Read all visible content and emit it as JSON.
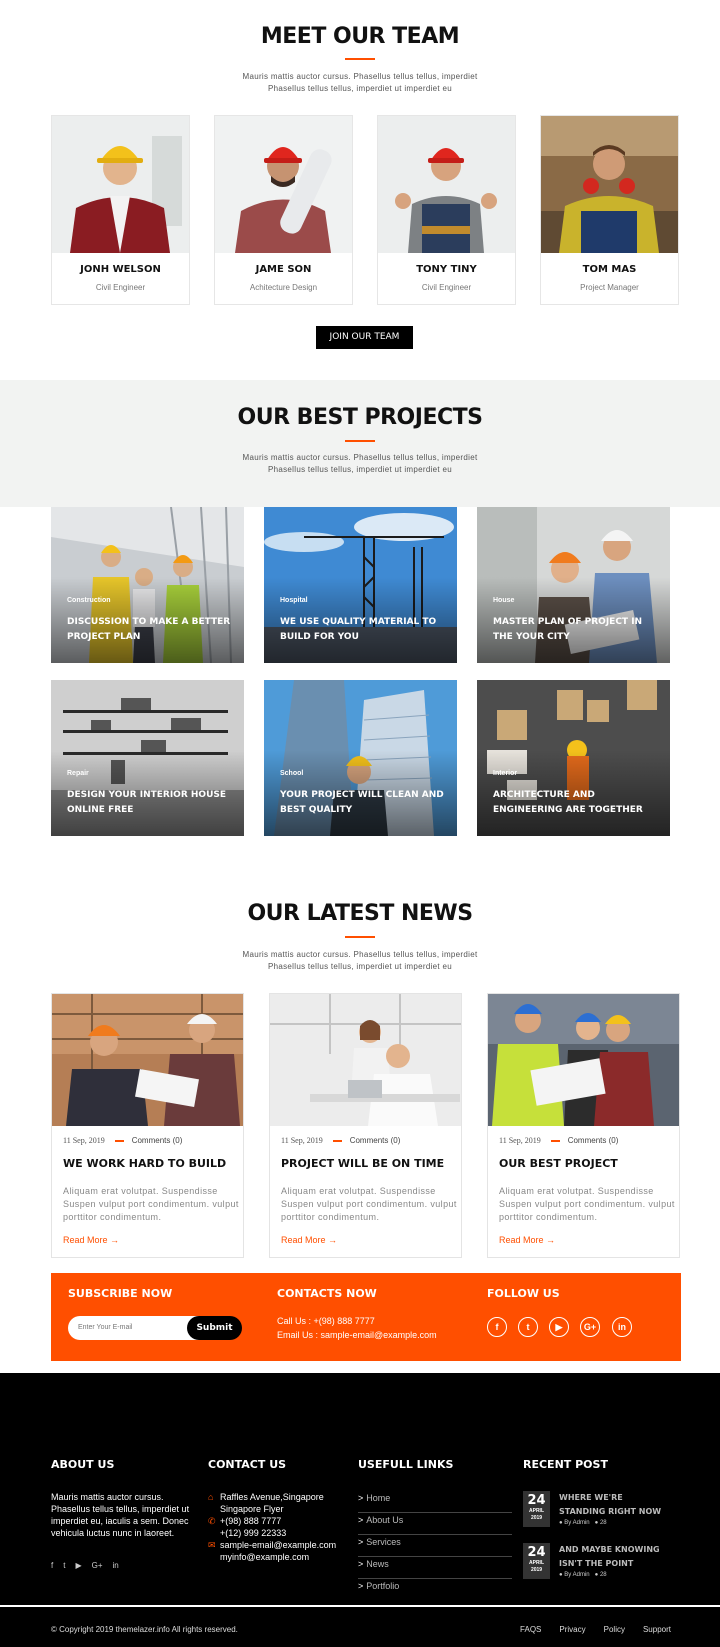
{
  "team_section": {
    "title": "MEET OUR TEAM",
    "subtitle_line1": "Mauris mattis auctor cursus. Phasellus tellus tellus, imperdiet",
    "subtitle_line2": "Phasellus tellus tellus, imperdiet ut imperdiet eu",
    "members": [
      {
        "name": "JONH WELSON",
        "role": "Civil Engineer"
      },
      {
        "name": "JAME SON",
        "role": "Achitecture Design"
      },
      {
        "name": "TONY TINY",
        "role": "Civil Engineer"
      },
      {
        "name": "TOM MAS",
        "role": "Project Manager"
      }
    ],
    "join_label": "JOIN OUR TEAM"
  },
  "projects_section": {
    "title": "OUR BEST PROJECTS",
    "subtitle_line1": "Mauris mattis auctor cursus. Phasellus tellus tellus, imperdiet",
    "subtitle_line2": "Phasellus tellus tellus, imperdiet ut imperdiet eu",
    "projects": [
      {
        "category": "Construction",
        "title": "DISCUSSION TO MAKE A BETTER PROJECT PLAN"
      },
      {
        "category": "Hospital",
        "title": "WE USE QUALITY MATERIAL TO BUILD FOR YOU"
      },
      {
        "category": "House",
        "title": "MASTER PLAN OF PROJECT IN THE YOUR CITY"
      },
      {
        "category": "Repair",
        "title": "DESIGN YOUR INTERIOR HOUSE ONLINE FREE"
      },
      {
        "category": "School",
        "title": "YOUR PROJECT WILL CLEAN AND BEST QUALITY"
      },
      {
        "category": "Interior",
        "title": "ARCHITECTURE AND ENGINEERING ARE TOGETHER"
      }
    ]
  },
  "news_section": {
    "title": "OUR LATEST NEWS",
    "subtitle_line1": "Mauris mattis auctor cursus. Phasellus tellus tellus, imperdiet",
    "subtitle_line2": "Phasellus tellus tellus, imperdiet ut imperdiet eu",
    "posts": [
      {
        "date": "11 Sep, 2019",
        "comments": "Comments (0)",
        "title": "WE WORK HARD TO BUILD",
        "excerpt": "Aliquam erat volutpat. Suspendisse Suspen vulput port condimentum. vulput porttitor condimentum.",
        "more": "Read More"
      },
      {
        "date": "11 Sep, 2019",
        "comments": "Comments (0)",
        "title": "PROJECT WILL BE ON TIME",
        "excerpt": "Aliquam erat volutpat. Suspendisse Suspen vulput port condimentum. vulput porttitor condimentum.",
        "more": "Read More"
      },
      {
        "date": "11 Sep, 2019",
        "comments": "Comments (0)",
        "title": "OUR BEST PROJECT",
        "excerpt": "Aliquam erat volutpat. Suspendisse Suspen vulput port condimentum. vulput porttitor condimentum.",
        "more": "Read More"
      }
    ]
  },
  "cta_bar": {
    "subscribe_heading": "SUBSCRIBE NOW",
    "email_placeholder": "Enter Your E-mail",
    "submit_label": "Submit",
    "contacts_heading": "CONTACTS NOW",
    "call": "Call Us : +(98) 888 7777",
    "email": "Email Us : sample-email@example.com",
    "follow_heading": "FOLLOW US",
    "social": [
      "f",
      "t",
      "▶",
      "G+",
      "in"
    ]
  },
  "footer": {
    "about_heading": "ABOUT US",
    "about_text": "Mauris mattis auctor cursus. Phasellus tellus tellus, imperdiet ut imperdiet eu, iaculis a sem. Donec vehicula luctus nunc in laoreet.",
    "about_social": [
      "f",
      "t",
      "▶",
      "G+",
      "in"
    ],
    "contact_heading": "CONTACT US",
    "address_line1": "Raffles Avenue,Singapore",
    "address_line2": "Singapore Flyer",
    "phone1": "+(98) 888 7777",
    "phone2": "+(12) 999 22333",
    "email1": "sample-email@example.com",
    "email2": "myinfo@example.com",
    "links_heading": "USEFULL LINKS",
    "links": [
      "Home",
      "About Us",
      "Services",
      "News",
      "Portfolio"
    ],
    "recent_heading": "RECENT POST",
    "recent_posts": [
      {
        "day": "24",
        "month": "APRIL",
        "year": "2019",
        "title": "WHERE WE'RE STANDING RIGHT NOW",
        "author": "By Admin",
        "comments": "28"
      },
      {
        "day": "24",
        "month": "APRIL",
        "year": "2019",
        "title": "AND MAYBE KNOWING ISN'T THE POINT",
        "author": "By Admin",
        "comments": "28"
      }
    ],
    "copyright": "© Copyright 2019 themelazer.info All rights reserved.",
    "bottom_links": [
      "FAQS",
      "Privacy",
      "Policy",
      "Support"
    ]
  },
  "colors": {
    "accent": "#ff4f00",
    "dark": "#000000",
    "band": "#f2f3f2"
  }
}
